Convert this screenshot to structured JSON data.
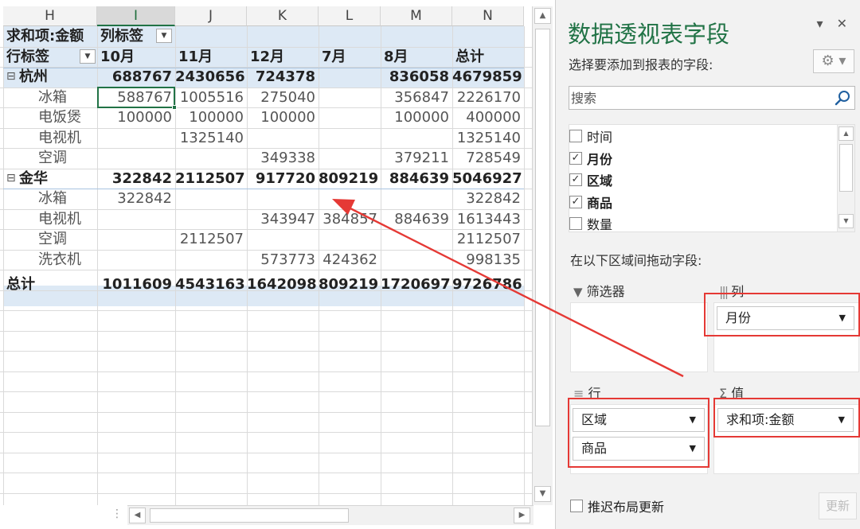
{
  "columns": [
    "H",
    "I",
    "J",
    "K",
    "L",
    "M",
    "N"
  ],
  "selected_column": "I",
  "pivot": {
    "value_header": "求和项:金额",
    "col_label_header": "列标签",
    "row_label_header": "行标签",
    "months": [
      "10月",
      "11月",
      "12月",
      "7月",
      "8月",
      "总计"
    ],
    "rows": [
      {
        "type": "group",
        "expander": "⊟",
        "label": "杭州",
        "values": [
          "688767",
          "2430656",
          "724378",
          "",
          "836058",
          "4679859"
        ]
      },
      {
        "type": "item",
        "label": "冰箱",
        "values": [
          "588767",
          "1005516",
          "275040",
          "",
          "356847",
          "2226170"
        ]
      },
      {
        "type": "item",
        "label": "电饭煲",
        "values": [
          "100000",
          "100000",
          "100000",
          "",
          "100000",
          "400000"
        ]
      },
      {
        "type": "item",
        "label": "电视机",
        "values": [
          "",
          "1325140",
          "",
          "",
          "",
          "1325140"
        ]
      },
      {
        "type": "item",
        "label": "空调",
        "values": [
          "",
          "",
          "349338",
          "",
          "379211",
          "728549"
        ]
      },
      {
        "type": "group",
        "expander": "⊟",
        "label": "金华",
        "values": [
          "322842",
          "2112507",
          "917720",
          "809219",
          "884639",
          "5046927"
        ]
      },
      {
        "type": "item",
        "label": "冰箱",
        "values": [
          "322842",
          "",
          "",
          "",
          "",
          "322842"
        ]
      },
      {
        "type": "item",
        "label": "电视机",
        "values": [
          "",
          "",
          "343947",
          "384857",
          "884639",
          "1613443"
        ]
      },
      {
        "type": "item",
        "label": "空调",
        "values": [
          "",
          "2112507",
          "",
          "",
          "",
          "2112507"
        ]
      },
      {
        "type": "item",
        "label": "洗衣机",
        "values": [
          "",
          "",
          "573773",
          "424362",
          "",
          "998135"
        ]
      },
      {
        "type": "total",
        "label": "总计",
        "values": [
          "1011609",
          "4543163",
          "1642098",
          "809219",
          "1720697",
          "9726786"
        ]
      }
    ]
  },
  "pane": {
    "title": "数据透视表字段",
    "controls": "▾ ✕",
    "subtitle": "选择要添加到报表的字段:",
    "gear_icon": "⚙ ▾",
    "search_placeholder": "搜索",
    "fields": [
      {
        "label": "时间",
        "checked": false
      },
      {
        "label": "月份",
        "checked": true
      },
      {
        "label": "区域",
        "checked": true
      },
      {
        "label": "商品",
        "checked": true
      },
      {
        "label": "数量",
        "checked": false
      }
    ],
    "drag_hint": "在以下区域间拖动字段:",
    "areas": {
      "filter": {
        "title": "筛选器",
        "items": []
      },
      "columns": {
        "title": "列",
        "items": [
          "月份"
        ]
      },
      "rows": {
        "title": "行",
        "items": [
          "区域",
          "商品"
        ]
      },
      "values": {
        "title": "值",
        "items": [
          "求和项:金额"
        ]
      }
    },
    "defer_label": "推迟布局更新",
    "update_label": "更新"
  },
  "colors": {
    "accent": "#217346",
    "highlight": "#e53935",
    "band": "#dde9f5"
  }
}
